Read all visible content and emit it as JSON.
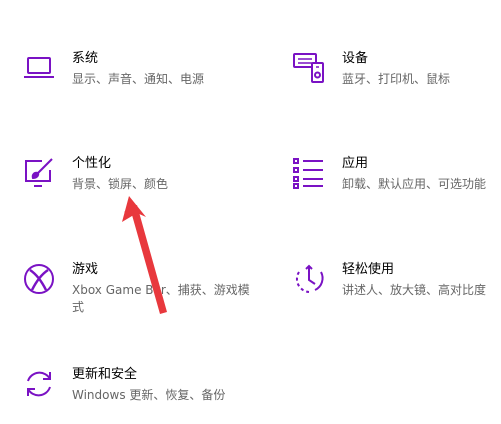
{
  "accent_color": "#7a12c4",
  "annotation_color": "#e8383d",
  "tiles": [
    {
      "icon": "laptop-icon",
      "title": "系统",
      "desc": "显示、声音、通知、电源"
    },
    {
      "icon": "devices-icon",
      "title": "设备",
      "desc": "蓝牙、打印机、鼠标"
    },
    {
      "icon": "personalization-icon",
      "title": "个性化",
      "desc": "背景、锁屏、颜色"
    },
    {
      "icon": "apps-icon",
      "title": "应用",
      "desc": "卸载、默认应用、可选功能"
    },
    {
      "icon": "xbox-icon",
      "title": "游戏",
      "desc": "Xbox Game Bar、捕获、游戏模式"
    },
    {
      "icon": "ease-of-access-icon",
      "title": "轻松使用",
      "desc": "讲述人、放大镜、高对比度"
    },
    {
      "icon": "update-security-icon",
      "title": "更新和安全",
      "desc": "Windows 更新、恢复、备份"
    }
  ]
}
